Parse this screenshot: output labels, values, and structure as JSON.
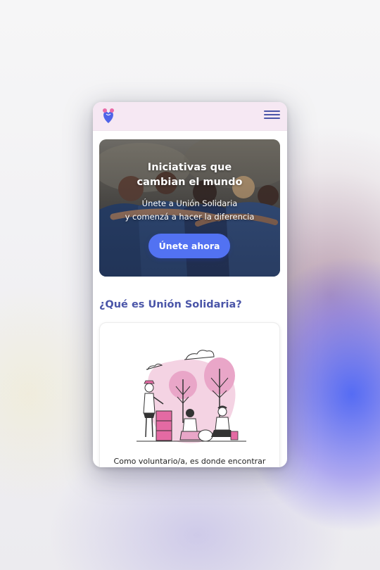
{
  "colors": {
    "brand": "#4a55a8",
    "accent_button": "#5272f2",
    "header_bg": "#f6e8f3",
    "illustration_pink": "#e9a6c8"
  },
  "header": {
    "logo_icon": "heart-logo-icon",
    "menu_icon": "hamburger-menu-icon"
  },
  "hero": {
    "title_line1": "Iniciativas que",
    "title_line2": "cambian el mundo",
    "subtitle_line1": "Únete a Unión Solidaria",
    "subtitle_line2": "y comenzá a hacer la diferencia",
    "cta_label": "Únete ahora"
  },
  "about": {
    "title": "¿Qué es Unión Solidaria?",
    "illustration_icon": "volunteers-illustration",
    "text": "Como voluntario/a, es donde encontrar"
  }
}
